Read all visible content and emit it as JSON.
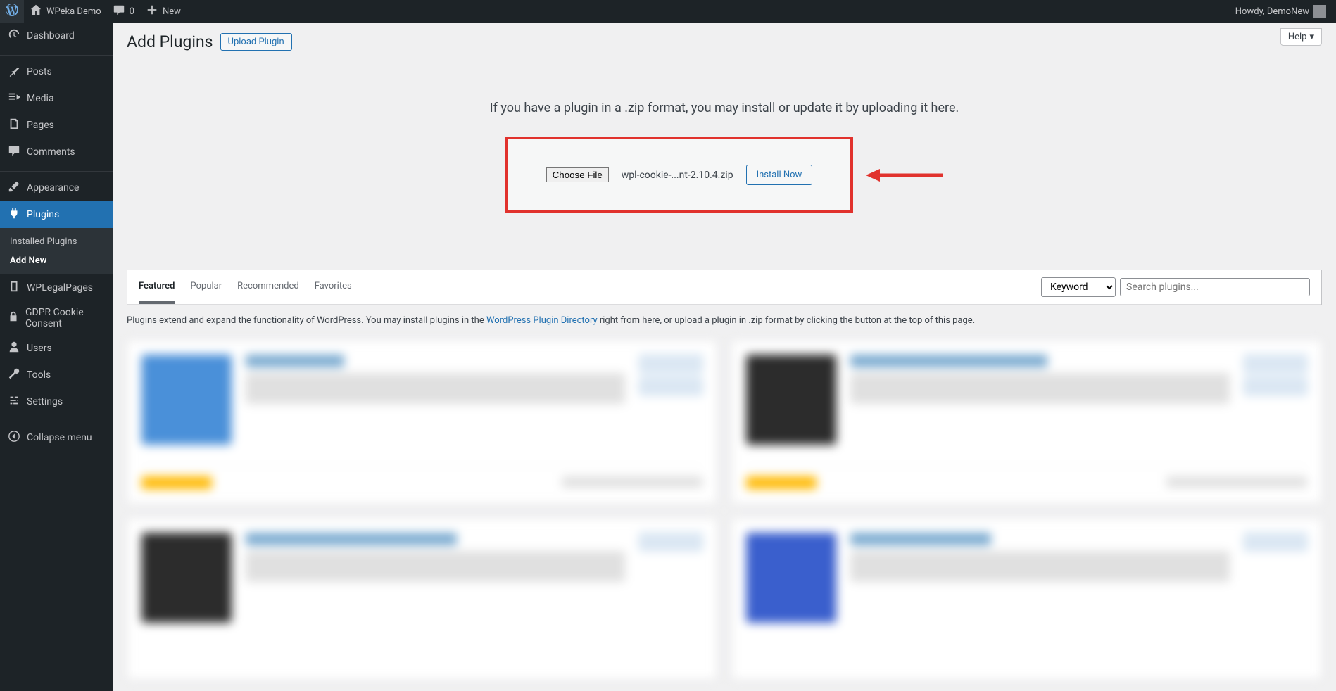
{
  "adminbar": {
    "site_name": "WPeka Demo",
    "comments_count": "0",
    "new_label": "New",
    "howdy": "Howdy, DemoNew"
  },
  "sidebar": {
    "dashboard": "Dashboard",
    "posts": "Posts",
    "media": "Media",
    "pages": "Pages",
    "comments": "Comments",
    "appearance": "Appearance",
    "plugins": "Plugins",
    "plugins_sub": {
      "installed": "Installed Plugins",
      "add_new": "Add New"
    },
    "wplegalpages": "WPLegalPages",
    "gdpr": "GDPR Cookie Consent",
    "users": "Users",
    "tools": "Tools",
    "settings": "Settings",
    "collapse": "Collapse menu"
  },
  "page": {
    "title": "Add Plugins",
    "upload_plugin_btn": "Upload Plugin",
    "help": "Help",
    "instructions": "If you have a plugin in a .zip format, you may install or update it by uploading it here.",
    "choose_file": "Choose File",
    "selected_file": "wpl-cookie-...nt-2.10.4.zip",
    "install_now": "Install Now"
  },
  "filter": {
    "tabs": {
      "featured": "Featured",
      "popular": "Popular",
      "recommended": "Recommended",
      "favorites": "Favorites"
    },
    "keyword_label": "Keyword",
    "search_placeholder": "Search plugins..."
  },
  "directory": {
    "prefix": "Plugins extend and expand the functionality of WordPress. You may install plugins in the ",
    "link": "WordPress Plugin Directory",
    "suffix": " right from here, or upload a plugin in .zip format by clicking the button at the top of this page."
  }
}
